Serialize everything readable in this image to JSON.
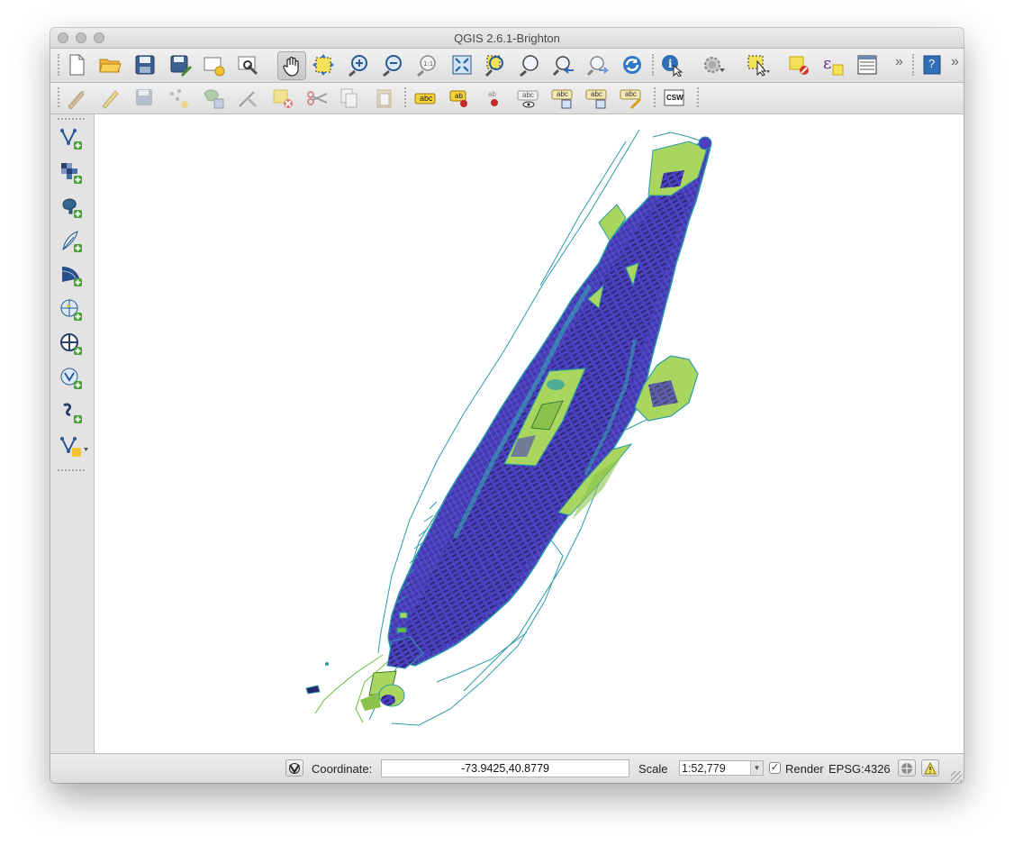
{
  "window": {
    "title": "QGIS 2.6.1-Brighton",
    "traffic_lights": [
      "close",
      "minimize",
      "zoom"
    ]
  },
  "toolbar_main": {
    "items": [
      {
        "name": "new-project-icon"
      },
      {
        "name": "open-project-icon"
      },
      {
        "name": "save-project-icon"
      },
      {
        "name": "save-project-as-icon"
      },
      {
        "name": "new-print-composer-icon"
      },
      {
        "name": "composer-manager-icon"
      },
      {
        "name": "pan-map-icon"
      },
      {
        "name": "pan-to-selection-icon"
      },
      {
        "name": "zoom-in-icon"
      },
      {
        "name": "zoom-out-icon"
      },
      {
        "name": "zoom-native-resolution-icon"
      },
      {
        "name": "zoom-full-icon"
      },
      {
        "name": "zoom-to-selection-icon"
      },
      {
        "name": "zoom-to-layer-icon"
      },
      {
        "name": "zoom-last-icon"
      },
      {
        "name": "zoom-next-icon"
      },
      {
        "name": "refresh-icon"
      },
      {
        "name": "identify-features-icon"
      },
      {
        "name": "run-feature-action-icon"
      },
      {
        "name": "select-features-icon"
      },
      {
        "name": "deselect-features-icon"
      },
      {
        "name": "field-calculator-icon"
      },
      {
        "name": "open-attribute-table-icon"
      },
      {
        "name": "help-icon",
        "label": "?"
      }
    ],
    "overflow_label": "»"
  },
  "toolbar_edit": {
    "items": [
      {
        "name": "current-edits-icon"
      },
      {
        "name": "toggle-editing-icon"
      },
      {
        "name": "save-layer-edits-icon"
      },
      {
        "name": "add-feature-icon"
      },
      {
        "name": "move-feature-icon"
      },
      {
        "name": "node-tool-icon"
      },
      {
        "name": "delete-selected-icon"
      },
      {
        "name": "cut-features-icon"
      },
      {
        "name": "copy-features-icon"
      },
      {
        "name": "paste-features-icon"
      },
      {
        "name": "label-icon",
        "label": "abc"
      },
      {
        "name": "pin-label-icon",
        "label": "ab"
      },
      {
        "name": "highlight-pinned-label-icon",
        "label": "ab"
      },
      {
        "name": "show-hide-label-icon",
        "label": "abc"
      },
      {
        "name": "move-label-icon",
        "label": "abc"
      },
      {
        "name": "rotate-label-icon",
        "label": "abc"
      },
      {
        "name": "change-label-icon",
        "label": "abc"
      },
      {
        "name": "csw-icon",
        "label": "CSW"
      }
    ]
  },
  "layers_toolbar": {
    "items": [
      {
        "name": "add-vector-layer-icon"
      },
      {
        "name": "add-raster-layer-icon"
      },
      {
        "name": "add-postgis-layer-icon"
      },
      {
        "name": "add-spatialite-layer-icon"
      },
      {
        "name": "add-mssql-layer-icon"
      },
      {
        "name": "add-wms-layer-icon"
      },
      {
        "name": "add-wcs-layer-icon"
      },
      {
        "name": "add-wfs-layer-icon"
      },
      {
        "name": "add-delimited-text-layer-icon"
      },
      {
        "name": "new-shapefile-layer-icon"
      }
    ]
  },
  "statusbar": {
    "coordinate_label": "Coordinate:",
    "coordinate_value": "-73.9425,40.8779",
    "scale_label": "Scale",
    "scale_value": "1:52,779",
    "render_label": "Render",
    "render_checked": "✓",
    "crs_label": "EPSG:4326"
  },
  "colors": {
    "map_fill_dark": "#4b3ec0",
    "map_fill_mid": "#3e7cb8",
    "map_park_green": "#a8d65e",
    "map_water_teal": "#2b9aa8"
  }
}
